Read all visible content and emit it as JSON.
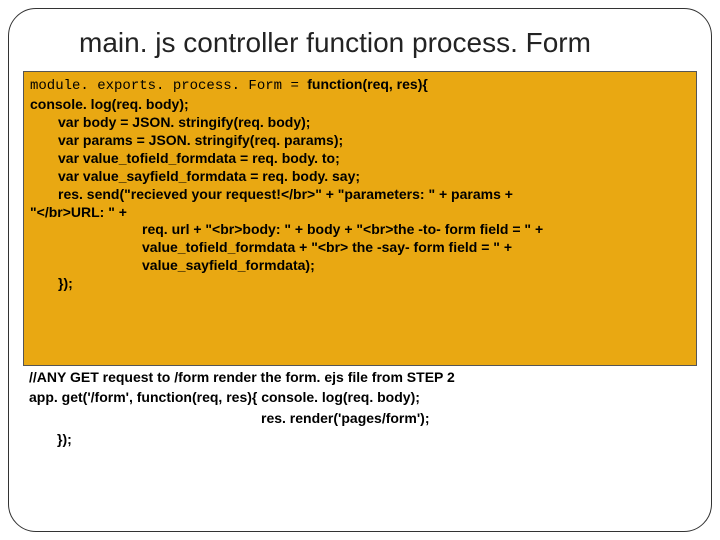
{
  "title": "main. js controller function process. Form",
  "code": {
    "l1_mono": "module. exports. process. Form = ",
    "l1_rest": "function(req, res){",
    "l2": "console. log(req. body);",
    "l3": "var body = JSON. stringify(req. body);",
    "l4": "var params = JSON. stringify(req. params);",
    "l5": "var value_tofield_formdata = req. body. to;",
    "l6": "var value_sayfield_formdata = req. body. say;",
    "l7": "res. send(\"recieved your request!</br>\" + \"parameters: \" + params +",
    "l8": "\"</br>URL: \" +",
    "l9": "req. url + \"<br>body: \" + body + \"<br>the -to- form field = \" +",
    "l10": "value_tofield_formdata + \"<br> the -say- form field = \" +",
    "l11": "value_sayfield_formdata);",
    "l12": "});"
  },
  "comment": {
    "c1": "//ANY GET request to /form render the form. ejs file from STEP 2",
    "c2": "app. get('/form', function(req, res){ console. log(req. body);",
    "c3": "res. render('pages/form');",
    "c4": "});"
  }
}
